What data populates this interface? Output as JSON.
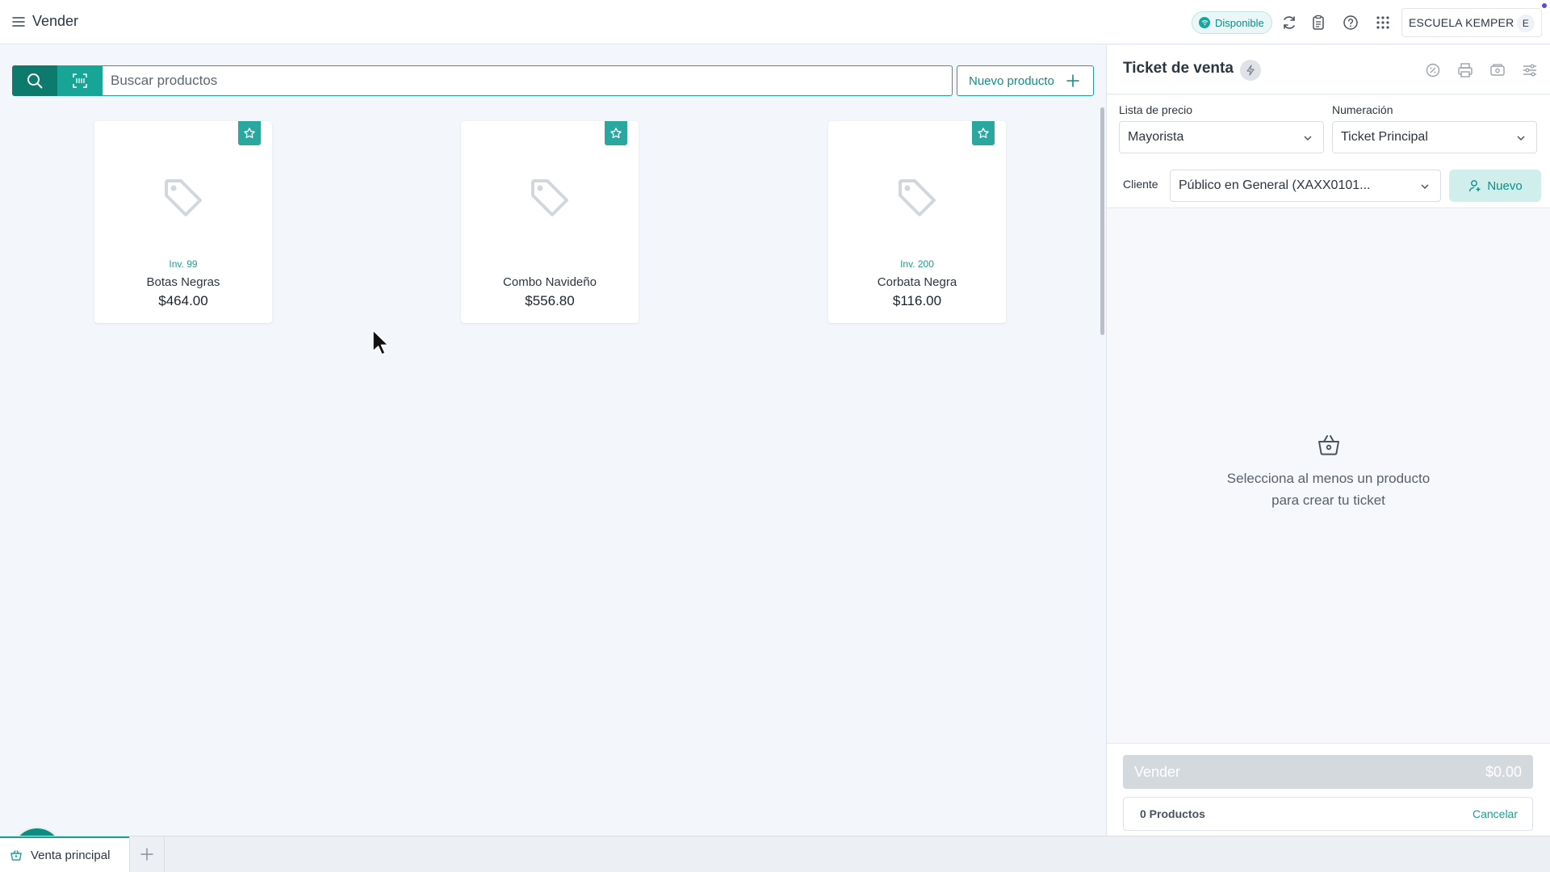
{
  "topbar": {
    "title": "Vender",
    "status": "Disponible",
    "school": "ESCUELA KEMPER",
    "avatar_initial": "E",
    "icons": [
      "menu-icon",
      "sync-icon",
      "clipboard-icon",
      "help-icon",
      "apps-grid-icon"
    ]
  },
  "search": {
    "placeholder": "Buscar productos",
    "new_product_label": "Nuevo producto"
  },
  "products": [
    {
      "inventory": "Inv. 99",
      "name": "Botas Negras",
      "price": "$464.00"
    },
    {
      "inventory": "",
      "name": "Combo Navideño",
      "price": "$556.80"
    },
    {
      "inventory": "Inv. 200",
      "name": "Corbata Negra",
      "price": "$116.00"
    }
  ],
  "ticket": {
    "title": "Ticket de venta",
    "price_list_label": "Lista de precio",
    "price_list_value": "Mayorista",
    "numbering_label": "Numeración",
    "numbering_value": "Ticket Principal",
    "client_label": "Cliente",
    "client_value": "Público en General (XAXX0101...",
    "new_client_label": "Nuevo",
    "empty_line1": "Selecciona al menos un producto",
    "empty_line2": "para crear tu ticket",
    "sell_label": "Vender",
    "sell_amount": "$0.00",
    "products_count": "0 Productos",
    "cancel_label": "Cancelar"
  },
  "tabs": {
    "active_label": "Venta principal"
  },
  "colors": {
    "primary": "#0d7a6e",
    "accent": "#16a596",
    "favorite": "#2aa79f"
  }
}
